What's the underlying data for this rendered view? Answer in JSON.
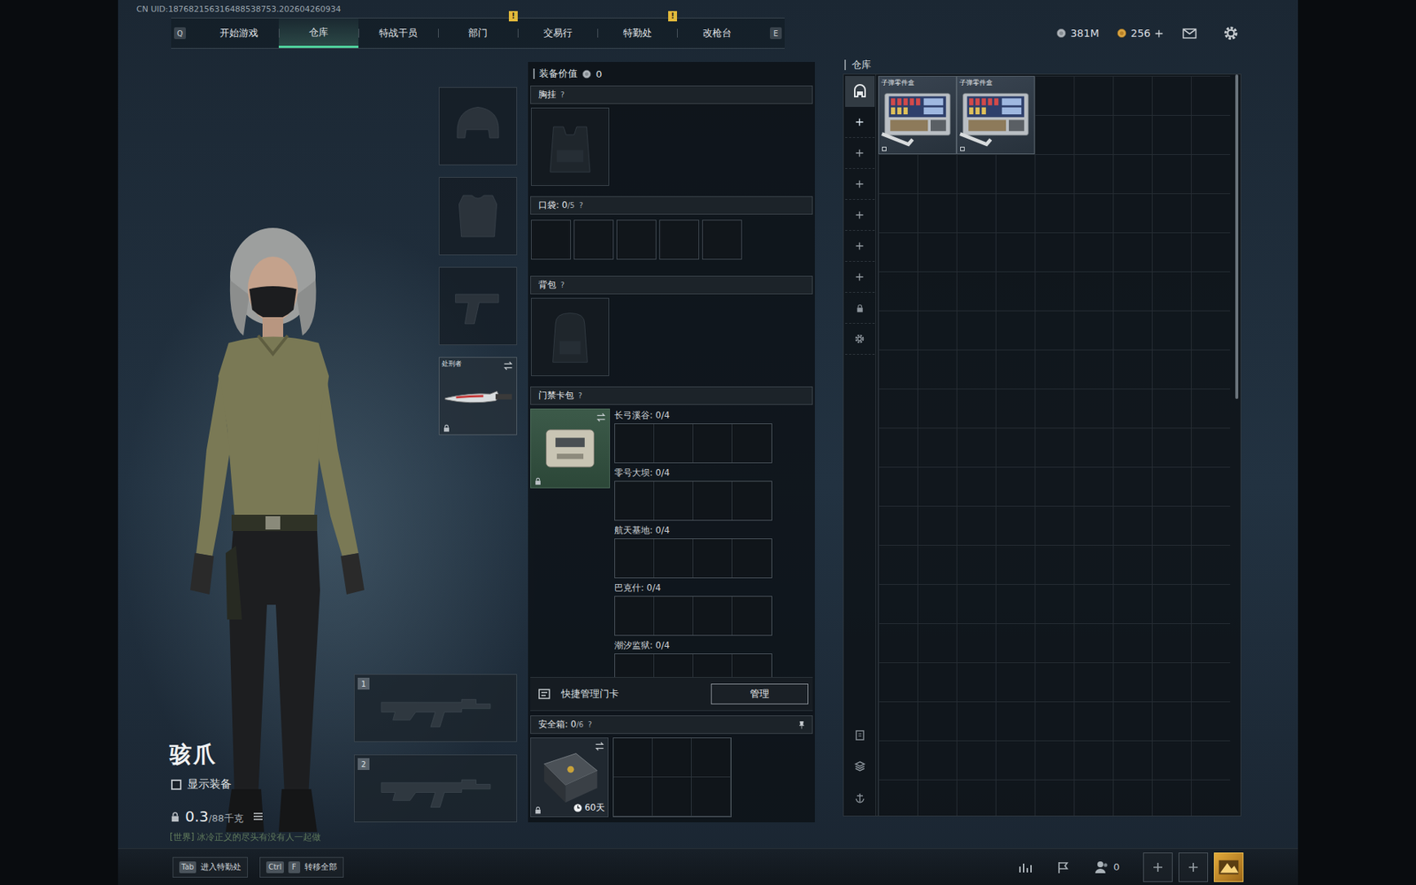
{
  "uid": "CN UID:187682156316488538753.202604260934",
  "nav": {
    "prev_key": "Q",
    "next_key": "E",
    "tabs": [
      {
        "label": "开始游戏",
        "selected": false,
        "badge": ""
      },
      {
        "label": "仓库",
        "selected": true,
        "badge": ""
      },
      {
        "label": "特战干员",
        "selected": false,
        "badge": ""
      },
      {
        "label": "部门",
        "selected": false,
        "badge": "!"
      },
      {
        "label": "交易行",
        "selected": false,
        "badge": ""
      },
      {
        "label": "特勤处",
        "selected": false,
        "badge": "!"
      },
      {
        "label": "改枪台",
        "selected": false,
        "badge": ""
      }
    ]
  },
  "currency": [
    {
      "kind": "silver",
      "amount": "381M"
    },
    {
      "kind": "gold",
      "amount": "256"
    }
  ],
  "character": {
    "name": "骇爪",
    "show_equipment": {
      "label": "显示装备",
      "checked": false
    },
    "weight": "0.3",
    "weight_max": "/88千克"
  },
  "chat": "[世界] 冰冷正义的尽头有没有人一起做",
  "gear_slots": [
    {
      "kind": "helmet",
      "filled": false
    },
    {
      "kind": "armor",
      "filled": false
    },
    {
      "kind": "pistol",
      "filled": false
    },
    {
      "kind": "melee",
      "filled": true,
      "label": "处刑者",
      "locked": true
    }
  ],
  "weapon_slots": [
    {
      "number": "1",
      "filled": false
    },
    {
      "number": "2",
      "filled": false
    }
  ],
  "loadout": {
    "value_label": "装备价值",
    "value": "0",
    "chest": {
      "label": "胸挂",
      "help": "?",
      "filled": false
    },
    "pockets": {
      "label": "口袋: 0",
      "capacity": "/5",
      "help": "?",
      "slots": 5
    },
    "backpack": {
      "label": "背包",
      "help": "?",
      "filled": false
    },
    "keycard": {
      "label": "门禁卡包",
      "help": "?",
      "locked": true,
      "maps": [
        {
          "name": "长弓溪谷: 0/4"
        },
        {
          "name": "零号大坝: 0/4"
        },
        {
          "name": "航天基地: 0/4"
        },
        {
          "name": "巴克什: 0/4"
        },
        {
          "name": "潮汐监狱: 0/4"
        }
      ]
    },
    "quick_manage": {
      "label": "快捷管理门卡",
      "button": "管理"
    },
    "safe": {
      "label": "安全箱: 0",
      "capacity": "/6",
      "help": "?",
      "timer": "60天",
      "locked": true,
      "slots": 6
    }
  },
  "warehouse": {
    "title": "仓库",
    "tabs": [
      {
        "kind": "home",
        "selected": true
      },
      {
        "kind": "add",
        "selected": false
      },
      {
        "kind": "add",
        "selected": false
      },
      {
        "kind": "add",
        "selected": false
      },
      {
        "kind": "add",
        "selected": false
      },
      {
        "kind": "add",
        "selected": false
      },
      {
        "kind": "add",
        "selected": false
      },
      {
        "kind": "lock",
        "selected": false
      },
      {
        "kind": "settings",
        "selected": false
      }
    ],
    "tools": [
      {
        "kind": "sort"
      },
      {
        "kind": "stack"
      },
      {
        "kind": "anchor"
      }
    ],
    "items": [
      {
        "name": "子弹零件盒"
      },
      {
        "name": "子弹零件盒"
      }
    ]
  },
  "hints": [
    {
      "keys": [
        "Tab"
      ],
      "label": "进入特勤处"
    },
    {
      "keys": [
        "Ctrl",
        "F"
      ],
      "label": "转移全部"
    }
  ],
  "social": {
    "friends": "0"
  }
}
